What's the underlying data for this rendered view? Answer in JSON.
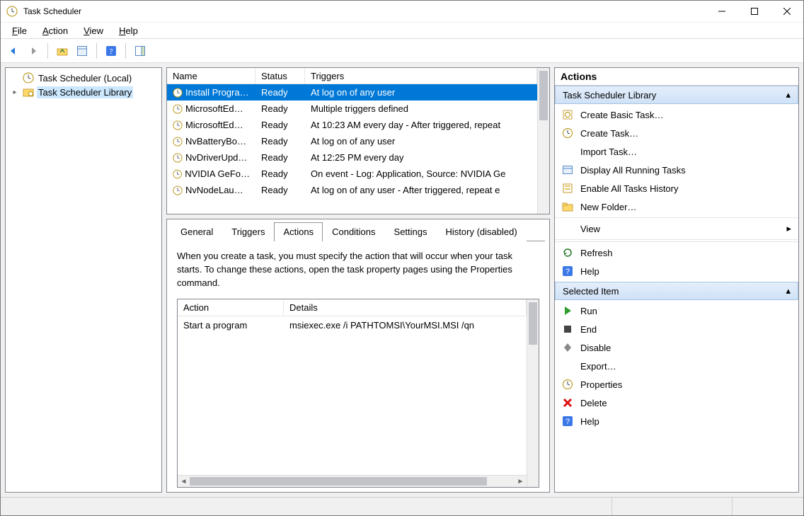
{
  "window": {
    "title": "Task Scheduler"
  },
  "menu": {
    "file": "File",
    "action": "Action",
    "view": "View",
    "help": "Help"
  },
  "tree": {
    "root": "Task Scheduler (Local)",
    "child": "Task Scheduler Library"
  },
  "task_list": {
    "columns": {
      "name": "Name",
      "status": "Status",
      "triggers": "Triggers"
    },
    "rows": [
      {
        "name": "Install Progra…",
        "status": "Ready",
        "trigger": "At log on of any user",
        "selected": true
      },
      {
        "name": "MicrosoftEd…",
        "status": "Ready",
        "trigger": "Multiple triggers defined"
      },
      {
        "name": "MicrosoftEd…",
        "status": "Ready",
        "trigger": "At 10:23 AM every day - After triggered, repeat "
      },
      {
        "name": "NvBatteryBo…",
        "status": "Ready",
        "trigger": "At log on of any user"
      },
      {
        "name": "NvDriverUpd…",
        "status": "Ready",
        "trigger": "At 12:25 PM every day"
      },
      {
        "name": "NVIDIA GeFo…",
        "status": "Ready",
        "trigger": "On event - Log: Application, Source: NVIDIA Ge"
      },
      {
        "name": "NvNodeLau…",
        "status": "Ready",
        "trigger": "At log on of any user - After triggered, repeat e"
      }
    ]
  },
  "tabs": {
    "general": "General",
    "triggers": "Triggers",
    "actions": "Actions",
    "conditions": "Conditions",
    "settings": "Settings",
    "history": "History (disabled)",
    "active": "actions"
  },
  "actions_tab": {
    "description": "When you create a task, you must specify the action that will occur when your task starts. To change these actions, open the task property pages using the Properties command.",
    "columns": {
      "action": "Action",
      "details": "Details"
    },
    "rows": [
      {
        "action": "Start a program",
        "details": "msiexec.exe /i PATHTOMSI\\YourMSI.MSI /qn"
      }
    ]
  },
  "actions_pane": {
    "title": "Actions",
    "section1": {
      "header": "Task Scheduler Library",
      "items": [
        "Create Basic Task…",
        "Create Task…",
        "Import Task…",
        "Display All Running Tasks",
        "Enable All Tasks History",
        "New Folder…",
        "View",
        "Refresh",
        "Help"
      ]
    },
    "section2": {
      "header": "Selected Item",
      "items": [
        "Run",
        "End",
        "Disable",
        "Export…",
        "Properties",
        "Delete",
        "Help"
      ]
    }
  }
}
